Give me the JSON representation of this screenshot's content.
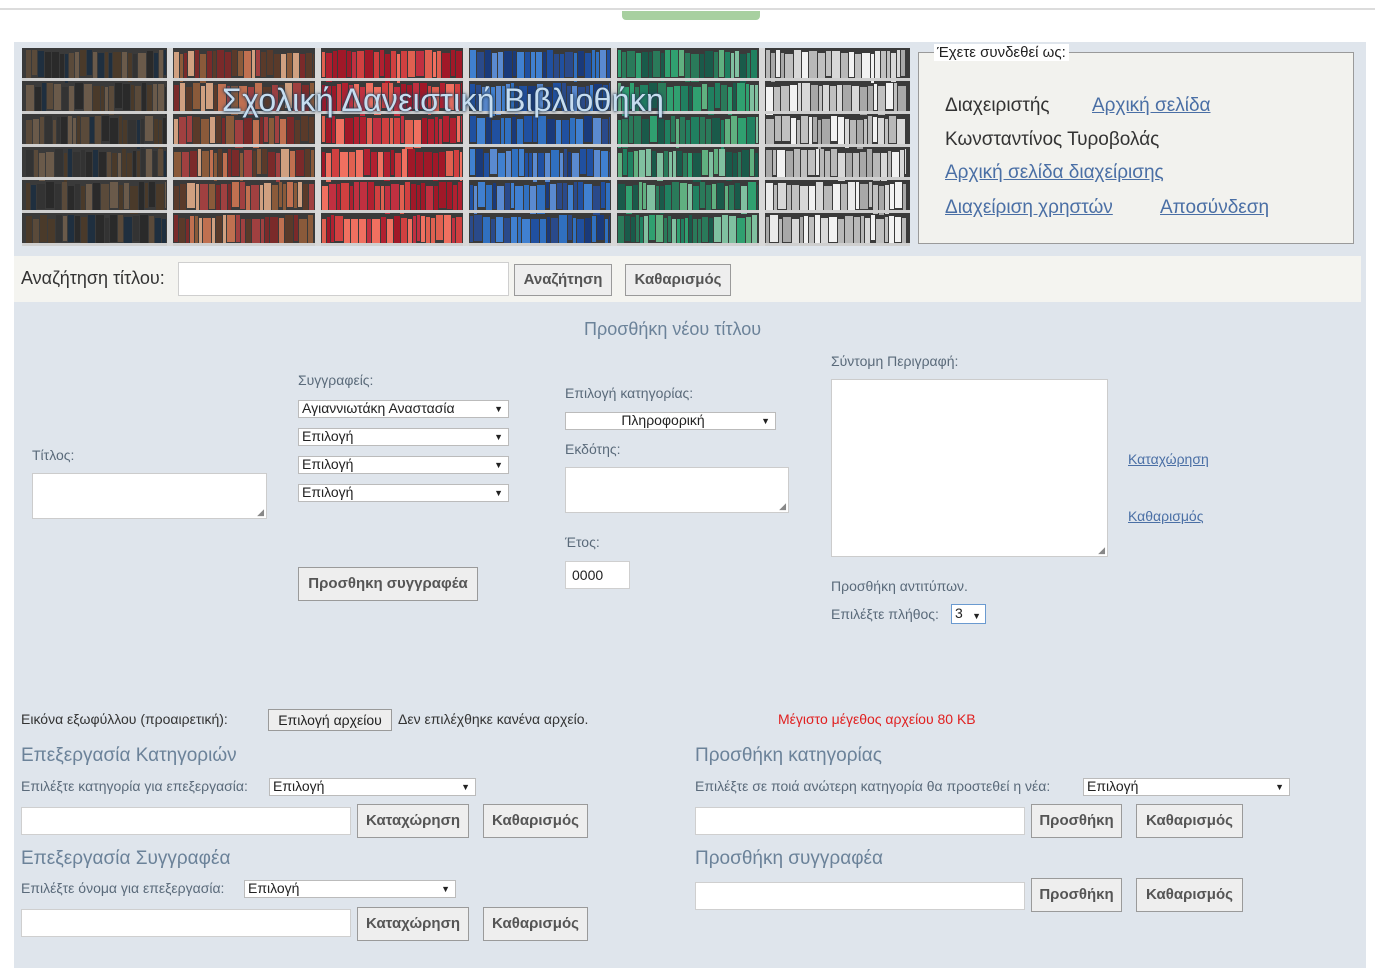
{
  "banner": {
    "title": "Σχολική Δανειστική Βιβλιοθήκη"
  },
  "login": {
    "legend": "Έχετε συνδεθεί ως:",
    "role": "Διαχειριστής",
    "home_link": "Αρχική σελίδα",
    "user_name": "Κωνσταντίνος Τυροβολάς",
    "admin_home_link": "Αρχική σελίδα διαχείρισης",
    "user_mgmt_link": "Διαχείριση χρηστών",
    "logout_link": "Αποσύνδεση"
  },
  "search": {
    "label": "Αναζήτηση τίτλου:",
    "value": "",
    "search_button": "Αναζήτηση",
    "clear_button": "Καθαρισμός"
  },
  "add_title": {
    "heading": "Προσθήκη νέου τίτλου",
    "title_label": "Τίτλος:",
    "authors_label": "Συγγραφείς:",
    "authors": [
      "Αγιαννιωτάκη Αναστασία",
      "Επιλογή",
      "Επιλογή",
      "Επιλογή"
    ],
    "add_author_button": "Προσθηκη συγγραφέα",
    "category_label": "Επιλογή κατηγορίας:",
    "category_value": "Πληροφορική",
    "publisher_label": "Εκδότης:",
    "year_label": "Έτος:",
    "year_value": "0000",
    "description_label": "Σύντομη Περιγραφή:",
    "copies_label": "Προσθήκη αντιτύπων.",
    "count_label": "Επιλέξτε πλήθος:",
    "count_value": "3",
    "submit_link": "Καταχώρηση",
    "clear_link": "Καθαρισμός",
    "cover_label": "Εικόνα εξωφύλλου (προαιρετική):",
    "file_button": "Επιλογή αρχείου",
    "file_status": "Δεν επιλέχθηκε κανένα αρχείο.",
    "max_size": "Μέγιστο μέγεθος αρχείου 80 KB"
  },
  "edit_category": {
    "heading": "Επεξεργασία Κατηγοριών",
    "select_label": "Επιλέξτε κατηγορία για επεξεργασία:",
    "select_value": "Επιλογή",
    "submit_button": "Καταχώρηση",
    "clear_button": "Καθαρισμός"
  },
  "add_category": {
    "heading": "Προσθήκη κατηγορίας",
    "select_label": "Επιλέξτε σε ποιά ανώτερη κατηγορία θα προστεθεί η νέα:",
    "select_value": "Επιλογή",
    "add_button": "Προσθήκη",
    "clear_button": "Καθαρισμός"
  },
  "edit_author": {
    "heading": "Επεξεργασία Συγγραφέα",
    "select_label": "Επιλέξτε όνομα για επεξεργασία:",
    "select_value": "Επιλογή",
    "submit_button": "Καταχώρηση",
    "clear_button": "Καθαρισμός"
  },
  "add_author": {
    "heading": "Προσθήκη συγγραφέα",
    "add_button": "Προσθήκη",
    "clear_button": "Καθαρισμός"
  }
}
